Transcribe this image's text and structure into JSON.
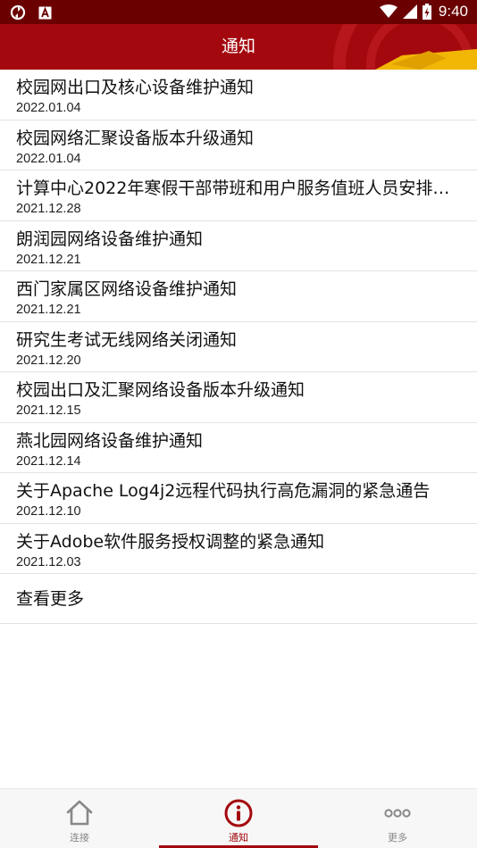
{
  "status_bar": {
    "time": "9:40",
    "icons": [
      "sync-icon",
      "app-a-icon",
      "wifi-icon",
      "signal-icon",
      "battery-charging-icon"
    ]
  },
  "header": {
    "title": "通知"
  },
  "notices": [
    {
      "title": "校园网出口及核心设备维护通知",
      "date": "2022.01.04"
    },
    {
      "title": "校园网络汇聚设备版本升级通知",
      "date": "2022.01.04"
    },
    {
      "title": "计算中心2022年寒假干部带班和用户服务值班人员安排…",
      "date": "2021.12.28"
    },
    {
      "title": "朗润园网络设备维护通知",
      "date": "2021.12.21"
    },
    {
      "title": "西门家属区网络设备维护通知",
      "date": "2021.12.21"
    },
    {
      "title": "研究生考试无线网络关闭通知",
      "date": "2021.12.20"
    },
    {
      "title": "校园出口及汇聚网络设备版本升级通知",
      "date": "2021.12.15"
    },
    {
      "title": "燕北园网络设备维护通知",
      "date": "2021.12.14"
    },
    {
      "title": "关于Apache Log4j2远程代码执行高危漏洞的紧急通告",
      "date": "2021.12.10"
    },
    {
      "title": "关于Adobe软件服务授权调整的紧急通知",
      "date": "2021.12.03"
    }
  ],
  "more_label": "查看更多",
  "bottom_nav": {
    "items": [
      {
        "label": "连接",
        "icon": "home-icon",
        "active": false
      },
      {
        "label": "通知",
        "icon": "info-icon",
        "active": true
      },
      {
        "label": "更多",
        "icon": "more-dots-icon",
        "active": false
      }
    ]
  },
  "colors": {
    "status_bar": "#6b0000",
    "header": "#a3080e",
    "accent": "#a3080e",
    "inactive": "#888888"
  }
}
